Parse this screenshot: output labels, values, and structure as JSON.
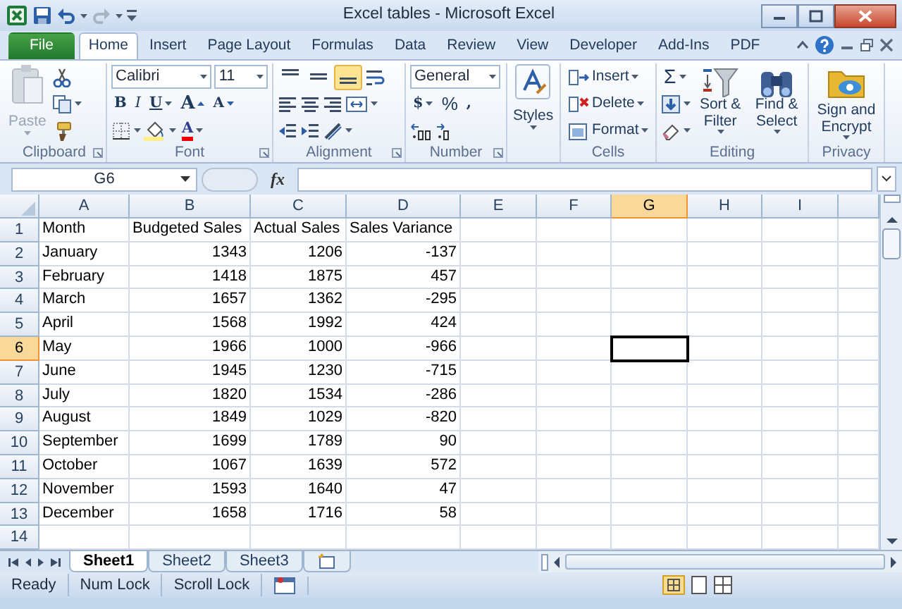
{
  "window": {
    "title": "Excel tables - Microsoft Excel"
  },
  "ribbon_tabs": [
    {
      "label": "File",
      "kind": "file",
      "selected": false
    },
    {
      "label": "Home",
      "kind": "tab",
      "selected": true
    },
    {
      "label": "Insert",
      "kind": "tab",
      "selected": false
    },
    {
      "label": "Page Layout",
      "kind": "tab",
      "selected": false
    },
    {
      "label": "Formulas",
      "kind": "tab",
      "selected": false
    },
    {
      "label": "Data",
      "kind": "tab",
      "selected": false
    },
    {
      "label": "Review",
      "kind": "tab",
      "selected": false
    },
    {
      "label": "View",
      "kind": "tab",
      "selected": false
    },
    {
      "label": "Developer",
      "kind": "tab",
      "selected": false
    },
    {
      "label": "Add-Ins",
      "kind": "tab",
      "selected": false
    },
    {
      "label": "PDF",
      "kind": "tab",
      "selected": false
    }
  ],
  "clipboard": {
    "label": "Clipboard",
    "paste": "Paste",
    "paste_disabled": true
  },
  "font": {
    "label": "Font",
    "name": "Calibri",
    "size": "11",
    "bold": "B",
    "italic": "I",
    "underline": "U",
    "grow": "A",
    "shrink": "A",
    "color_button": "A"
  },
  "alignment": {
    "label": "Alignment",
    "vertical": [
      {
        "kind": "top",
        "selected": false
      },
      {
        "kind": "middle",
        "selected": false
      },
      {
        "kind": "bottom",
        "selected": true
      }
    ]
  },
  "number": {
    "label": "Number",
    "format": "General",
    "currency": "$",
    "percent": "%",
    "comma": ","
  },
  "styles": {
    "button": "Styles"
  },
  "cells": {
    "label": "Cells",
    "buttons": [
      {
        "kind": "insert",
        "label": "Insert"
      },
      {
        "kind": "delete",
        "label": "Delete"
      },
      {
        "kind": "format",
        "label": "Format"
      }
    ]
  },
  "editing": {
    "label": "Editing",
    "autosum": "Σ",
    "sort": "Sort & Filter",
    "find": "Find & Select"
  },
  "privacy": {
    "label": "Privacy",
    "button": "Sign and Encrypt"
  },
  "formula_bar": {
    "name_box": "G6",
    "fx": "fx"
  },
  "columns": [
    {
      "label": "A",
      "selected": false
    },
    {
      "label": "B",
      "selected": false
    },
    {
      "label": "C",
      "selected": false
    },
    {
      "label": "D",
      "selected": false
    },
    {
      "label": "E",
      "selected": false
    },
    {
      "label": "F",
      "selected": false
    },
    {
      "label": "G",
      "selected": true
    },
    {
      "label": "H",
      "selected": false
    },
    {
      "label": "I",
      "selected": false
    }
  ],
  "rows": [
    {
      "number": "1",
      "kind": "text",
      "selected": false,
      "cells": [
        "Month",
        "Budgeted Sales",
        "Actual Sales",
        "Sales Variance"
      ]
    },
    {
      "number": "2",
      "kind": "data",
      "selected": false,
      "cells": [
        "January",
        "1343",
        "1206",
        "-137"
      ]
    },
    {
      "number": "3",
      "kind": "data",
      "selected": false,
      "cells": [
        "February",
        "1418",
        "1875",
        "457"
      ]
    },
    {
      "number": "4",
      "kind": "data",
      "selected": false,
      "cells": [
        "March",
        "1657",
        "1362",
        "-295"
      ]
    },
    {
      "number": "5",
      "kind": "data",
      "selected": false,
      "cells": [
        "April",
        "1568",
        "1992",
        "424"
      ]
    },
    {
      "number": "6",
      "kind": "data",
      "selected": true,
      "cells": [
        "May",
        "1966",
        "1000",
        "-966"
      ]
    },
    {
      "number": "7",
      "kind": "data",
      "selected": false,
      "cells": [
        "June",
        "1945",
        "1230",
        "-715"
      ]
    },
    {
      "number": "8",
      "kind": "data",
      "selected": false,
      "cells": [
        "July",
        "1820",
        "1534",
        "-286"
      ]
    },
    {
      "number": "9",
      "kind": "data",
      "selected": false,
      "cells": [
        "August",
        "1849",
        "1029",
        "-820"
      ]
    },
    {
      "number": "10",
      "kind": "data",
      "selected": false,
      "cells": [
        "September",
        "1699",
        "1789",
        "90"
      ]
    },
    {
      "number": "11",
      "kind": "data",
      "selected": false,
      "cells": [
        "October",
        "1067",
        "1639",
        "572"
      ]
    },
    {
      "number": "12",
      "kind": "data",
      "selected": false,
      "cells": [
        "November",
        "1593",
        "1640",
        "47"
      ]
    },
    {
      "number": "13",
      "kind": "data",
      "selected": false,
      "cells": [
        "December",
        "1658",
        "1716",
        "58"
      ]
    },
    {
      "number": "14",
      "kind": "data",
      "selected": false
    }
  ],
  "sheet_tabs": [
    {
      "label": "Sheet1",
      "selected": true
    },
    {
      "label": "Sheet2",
      "selected": false
    },
    {
      "label": "Sheet3",
      "selected": false
    }
  ],
  "status_bar": [
    "Ready",
    "Num Lock",
    "Scroll Lock"
  ]
}
